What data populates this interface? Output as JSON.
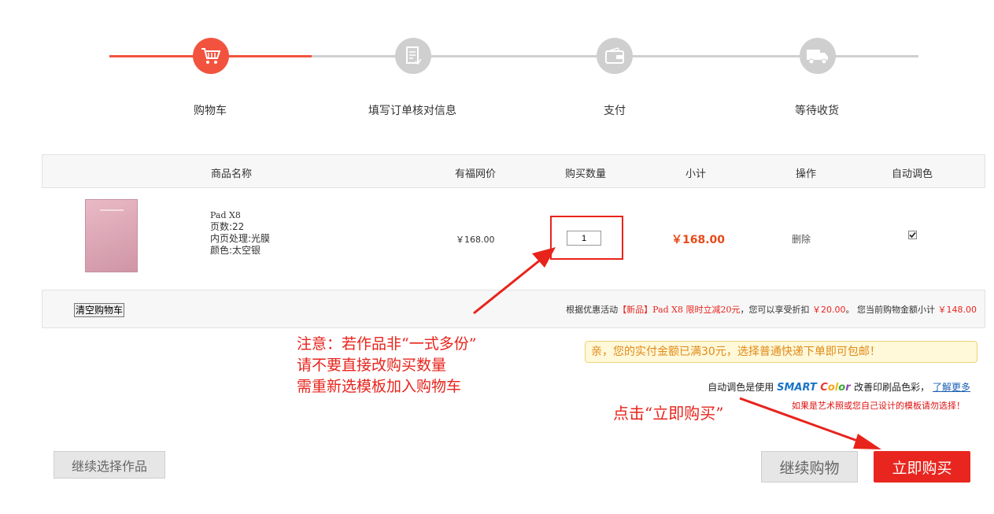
{
  "steps": [
    {
      "label": "购物车",
      "icon": "cart-icon",
      "active": true
    },
    {
      "label": "填写订单核对信息",
      "icon": "document-icon",
      "active": false
    },
    {
      "label": "支付",
      "icon": "wallet-icon",
      "active": false
    },
    {
      "label": "等待收货",
      "icon": "truck-icon",
      "active": false
    }
  ],
  "colors": {
    "accent": "#f2533e",
    "inactive": "#cfcfcf",
    "price": "#e64a19",
    "red": "#e8261f"
  },
  "table": {
    "headers": {
      "name": "商品名称",
      "price": "有福网价",
      "qty": "购买数量",
      "subtotal": "小计",
      "op": "操作",
      "auto_color": "自动调色"
    },
    "item": {
      "name": "Pad X8",
      "pages": "页数:22",
      "finish": "内页处理:光膜",
      "color": "颜色:太空银",
      "price": "￥168.00",
      "quantity": "1",
      "subtotal": "￥168.00",
      "delete": "删除",
      "auto_color_checked": true
    }
  },
  "footer": {
    "clear_cart": "清空购物车",
    "promo_prefix": "根据优惠活动",
    "promo_tag": "【新品】",
    "promo_name": "Pad X8 限时立减20元",
    "promo_mid": "，您可以享受折扣",
    "promo_discount": "￥20.00",
    "promo_mid2": "。 您当前购物金额小计",
    "promo_total": "￥148.00"
  },
  "notice": "亲，您的实付金额已满30元，选择普通快递下单即可包邮！",
  "smart": {
    "prefix": "自动调色是使用",
    "smart_word": "SMART",
    "color_letters": [
      "C",
      "o",
      "l",
      "o",
      "r"
    ],
    "suffix": "改善印刷品色彩，",
    "learn_more": "了解更多",
    "warning": "如果是艺术照或您自己设计的模板请勿选择！"
  },
  "annotations": {
    "note_line1": "注意：若作品非“一式多份”",
    "note_line2": "请不要直接改购买数量",
    "note_line3": "需重新选模板加入购物车",
    "click_buy": "点击“立即购买”"
  },
  "buttons": {
    "continue_select": "继续选择作品",
    "continue_shopping": "继续购物",
    "buy_now": "立即购买"
  }
}
